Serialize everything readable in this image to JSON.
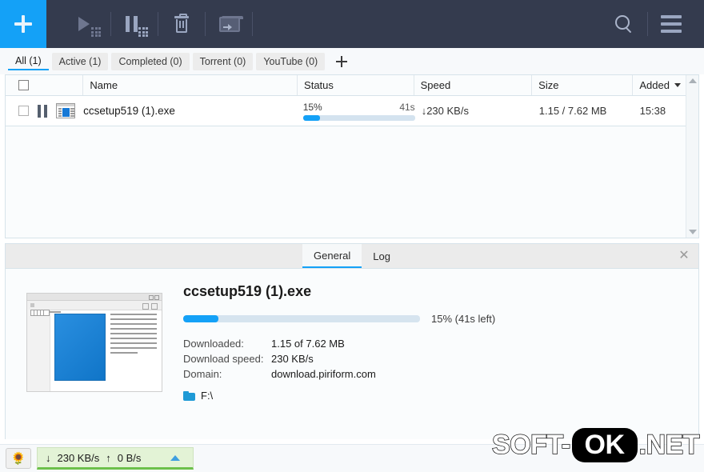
{
  "toolbar": {
    "add_label": "+",
    "items": [
      {
        "name": "start-download",
        "icon": "play-icon"
      },
      {
        "name": "pause-download",
        "icon": "pause-icon"
      },
      {
        "name": "delete-download",
        "icon": "trash-icon"
      },
      {
        "name": "move-download",
        "icon": "move-to-folder-icon"
      }
    ],
    "search_icon": "search-icon",
    "menu_icon": "hamburger-menu-icon"
  },
  "tabs": [
    {
      "label": "All (1)",
      "active": true
    },
    {
      "label": "Active (1)",
      "active": false
    },
    {
      "label": "Completed (0)",
      "active": false
    },
    {
      "label": "Torrent (0)",
      "active": false
    },
    {
      "label": "YouTube (0)",
      "active": false
    }
  ],
  "tab_add_label": "+",
  "table": {
    "columns": [
      "",
      "Name",
      "Status",
      "Speed",
      "Size",
      "Added"
    ],
    "sort_column": "Added",
    "rows": [
      {
        "name": "ccsetup519 (1).exe",
        "percent_label": "15%",
        "percent_value": 15,
        "eta": "41s",
        "speed": "↓230 KB/s",
        "size": "1.15 / 7.62 MB",
        "added": "15:38",
        "state": "paused-toggle"
      }
    ]
  },
  "detail": {
    "tabs": [
      {
        "label": "General",
        "active": true
      },
      {
        "label": "Log",
        "active": false
      }
    ],
    "close_label": "✕",
    "title": "ccsetup519 (1).exe",
    "progress_percent": 15,
    "progress_label": "15% (41s left)",
    "fields": [
      {
        "key": "Downloaded:",
        "value": "1.15 of 7.62 MB"
      },
      {
        "key": "Download speed:",
        "value": "230 KB/s"
      },
      {
        "key": "Domain:",
        "value": "download.piriform.com"
      }
    ],
    "path": "F:\\"
  },
  "status_bar": {
    "speed_limit_icon": "snail-icon",
    "download_arrow": "↓",
    "download_speed": "230 KB/s",
    "upload_arrow": "↑",
    "upload_speed": "0 B/s",
    "expand_icon": "chevron-up-icon"
  },
  "watermark": {
    "part1": "SOFT-",
    "part2": "OK",
    "part3": ".NET"
  },
  "colors": {
    "accent": "#14a1f7",
    "toolbar_bg": "#343b4e",
    "panel_bg": "#fafcfd",
    "speed_panel": "#e3f3d6",
    "speed_underline": "#6cc04a"
  }
}
